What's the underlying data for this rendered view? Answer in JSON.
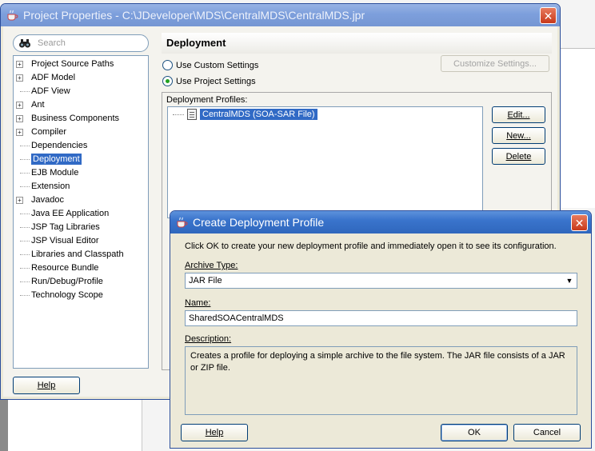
{
  "project_properties": {
    "title": "Project Properties - C:\\JDeveloper\\MDS\\CentralMDS\\CentralMDS.jpr",
    "search_placeholder": "Search",
    "tree_items": [
      {
        "label": "Project Source Paths",
        "expandable": true
      },
      {
        "label": "ADF Model",
        "expandable": true
      },
      {
        "label": "ADF View",
        "expandable": false
      },
      {
        "label": "Ant",
        "expandable": true
      },
      {
        "label": "Business Components",
        "expandable": true
      },
      {
        "label": "Compiler",
        "expandable": true
      },
      {
        "label": "Dependencies",
        "expandable": false
      },
      {
        "label": "Deployment",
        "expandable": false,
        "selected": true
      },
      {
        "label": "EJB Module",
        "expandable": false
      },
      {
        "label": "Extension",
        "expandable": false
      },
      {
        "label": "Javadoc",
        "expandable": true
      },
      {
        "label": "Java EE Application",
        "expandable": false
      },
      {
        "label": "JSP Tag Libraries",
        "expandable": false
      },
      {
        "label": "JSP Visual Editor",
        "expandable": false
      },
      {
        "label": "Libraries and Classpath",
        "expandable": false
      },
      {
        "label": "Resource Bundle",
        "expandable": false
      },
      {
        "label": "Run/Debug/Profile",
        "expandable": false
      },
      {
        "label": "Technology Scope",
        "expandable": false
      }
    ],
    "help_label": "Help",
    "panel_heading": "Deployment",
    "radio_custom": "Use Custom Settings",
    "radio_project": "Use Project Settings",
    "customize_label": "Customize Settings...",
    "profiles_label": "Deployment Profiles:",
    "profile_item": "CentralMDS (SOA-SAR File)",
    "edit_label": "Edit...",
    "new_label": "New...",
    "delete_label": "Delete"
  },
  "create_profile": {
    "title": "Create Deployment Profile",
    "intro": "Click OK to create your new deployment profile and immediately open it to see its configuration.",
    "archive_type_label": "Archive Type:",
    "archive_type_value": "JAR File",
    "name_label": "Name:",
    "name_value": "SharedSOACentralMDS",
    "description_label": "Description:",
    "description_value": "Creates a profile for deploying a simple archive to the file system. The JAR file consists of a JAR or ZIP file.",
    "help_label": "Help",
    "ok_label": "OK",
    "cancel_label": "Cancel"
  },
  "colors": {
    "titlebar_active": "#3a74cc",
    "selection": "#316ac5",
    "close_button": "#c8391a"
  }
}
